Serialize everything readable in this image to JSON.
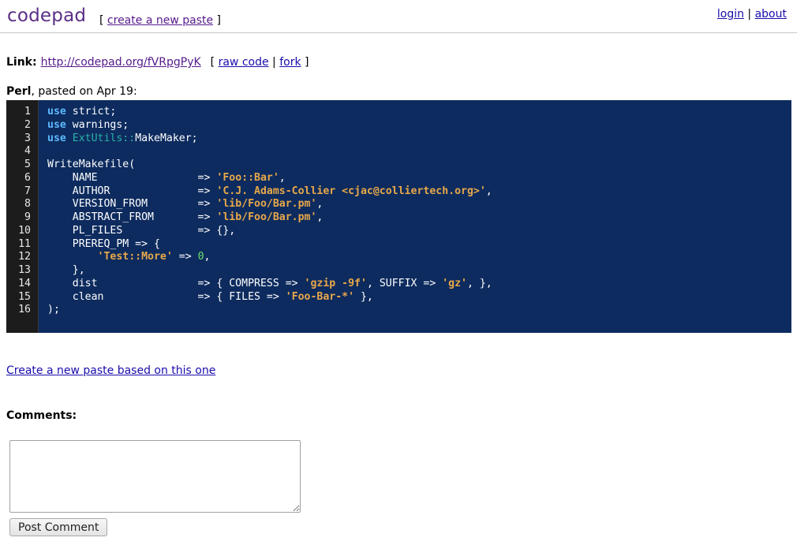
{
  "header": {
    "logo": "codepad",
    "create_prefix": "[ ",
    "create_label": "create a new paste",
    "create_suffix": " ]",
    "login_label": "login",
    "separator": " | ",
    "about_label": "about"
  },
  "link_row": {
    "label": "Link:",
    "url": "http://codepad.org/fVRpgPyK",
    "tools_prefix": "[ ",
    "raw_code_label": "raw code",
    "tools_separator": " | ",
    "fork_label": "fork",
    "tools_suffix": " ]"
  },
  "paste": {
    "language": "Perl",
    "pasted_on": ", pasted on Apr 19:",
    "line_numbers": [
      "1",
      "2",
      "3",
      "4",
      "5",
      "6",
      "7",
      "8",
      "9",
      "10",
      "11",
      "12",
      "13",
      "14",
      "15",
      "16"
    ]
  },
  "code_lines": [
    [
      {
        "t": "use",
        "c": "kw"
      },
      {
        "t": " strict;"
      }
    ],
    [
      {
        "t": "use",
        "c": "kw"
      },
      {
        "t": " warnings;"
      }
    ],
    [
      {
        "t": "use",
        "c": "kw"
      },
      {
        "t": " "
      },
      {
        "t": "ExtUtils::",
        "c": "ns"
      },
      {
        "t": "MakeMaker;"
      }
    ],
    [
      {
        "t": ""
      }
    ],
    [
      {
        "t": "WriteMakefile("
      }
    ],
    [
      {
        "t": "    NAME                => "
      },
      {
        "t": "'Foo::Bar'",
        "c": "str"
      },
      {
        "t": ","
      }
    ],
    [
      {
        "t": "    AUTHOR              => "
      },
      {
        "t": "'C.J. Adams-Collier <cjac@colliertech.org>'",
        "c": "str"
      },
      {
        "t": ","
      }
    ],
    [
      {
        "t": "    VERSION_FROM        => "
      },
      {
        "t": "'lib/Foo/Bar.pm'",
        "c": "str"
      },
      {
        "t": ","
      }
    ],
    [
      {
        "t": "    ABSTRACT_FROM       => "
      },
      {
        "t": "'lib/Foo/Bar.pm'",
        "c": "str"
      },
      {
        "t": ","
      }
    ],
    [
      {
        "t": "    PL_FILES            => {},"
      }
    ],
    [
      {
        "t": "    PREREQ_PM => {"
      }
    ],
    [
      {
        "t": "        "
      },
      {
        "t": "'Test::More'",
        "c": "str"
      },
      {
        "t": " => "
      },
      {
        "t": "0",
        "c": "num"
      },
      {
        "t": ","
      }
    ],
    [
      {
        "t": "    },"
      }
    ],
    [
      {
        "t": "    dist                => { COMPRESS => "
      },
      {
        "t": "'gzip -9f'",
        "c": "str"
      },
      {
        "t": ", SUFFIX => "
      },
      {
        "t": "'gz'",
        "c": "str"
      },
      {
        "t": ", },"
      }
    ],
    [
      {
        "t": "    clean               => { FILES => "
      },
      {
        "t": "'Foo-Bar-*'",
        "c": "str"
      },
      {
        "t": " },"
      }
    ],
    [
      {
        "t": ");"
      }
    ]
  ],
  "footer": {
    "new_paste_link": "Create a new paste based on this one",
    "comments_label": "Comments:",
    "comment_value": "",
    "post_button": "Post Comment"
  },
  "colors": {
    "code_background": "#0d2b5e",
    "gutter_background": "#1c1c1c",
    "keyword": "#5cb8ff",
    "string": "#e8a84a",
    "number": "#6ee06e",
    "namespace": "#2bb0a8",
    "logo": "#5b2e86"
  }
}
